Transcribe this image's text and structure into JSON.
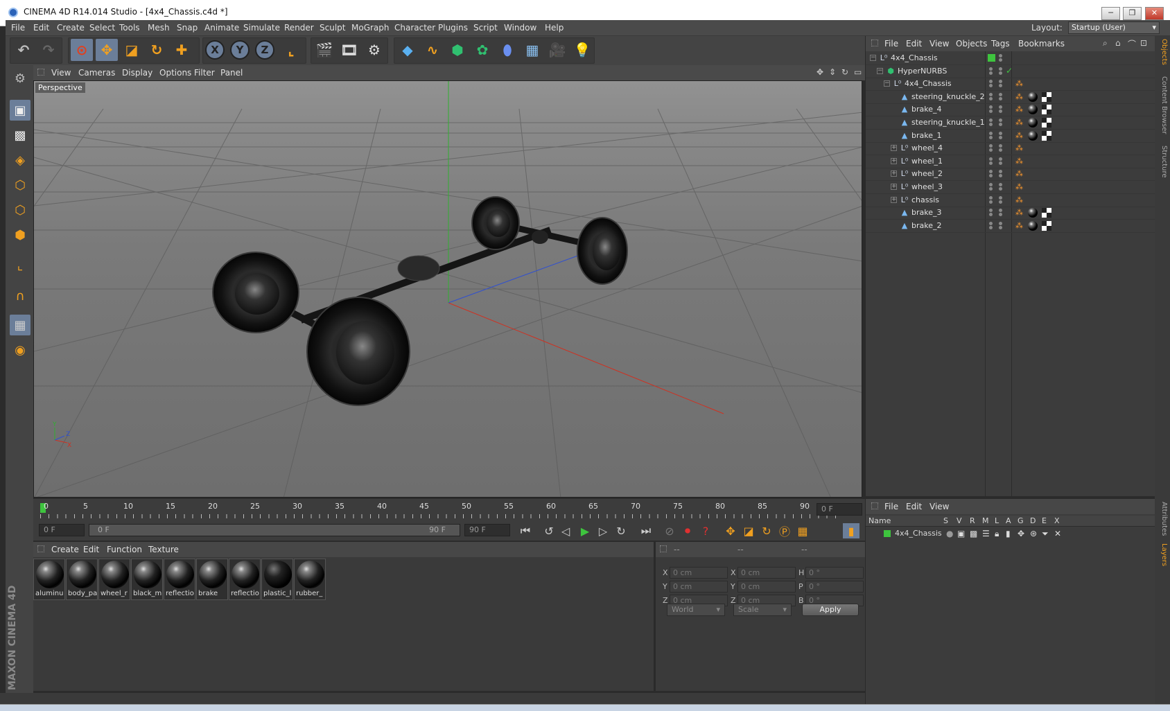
{
  "window": {
    "title": "CINEMA 4D R14.014 Studio - [4x4_Chassis.c4d *]",
    "minimize": "─",
    "restore": "❐",
    "close": "✕"
  },
  "menu": [
    "File",
    "Edit",
    "Create",
    "Select",
    "Tools",
    "Mesh",
    "Snap",
    "Animate",
    "Simulate",
    "Render",
    "Sculpt",
    "MoGraph",
    "Character",
    "Plugins",
    "Script",
    "Window",
    "Help"
  ],
  "layout": {
    "label": "Layout:",
    "value": "Startup (User)"
  },
  "viewport": {
    "menu": [
      "View",
      "Cameras",
      "Display",
      "Options",
      "Filter",
      "Panel"
    ],
    "camera_label": "Perspective",
    "axis_y": "Y",
    "axis_z": "Z",
    "axis_x": "X"
  },
  "timeline": {
    "ticks": [
      "0",
      "5",
      "10",
      "15",
      "20",
      "25",
      "30",
      "35",
      "40",
      "45",
      "50",
      "55",
      "60",
      "65",
      "70",
      "75",
      "80",
      "85",
      "90"
    ],
    "end_frame": "0 F",
    "current_frame": "0 F",
    "range_start": "0 F",
    "range_end": "90 F",
    "max_frame": "90 F"
  },
  "material_panel": {
    "menu": [
      "Create",
      "Edit",
      "Function",
      "Texture"
    ],
    "materials": [
      "aluminu",
      "body_pa",
      "wheel_r",
      "black_m",
      "reflectio",
      "brake",
      "reflectio",
      "plastic_l",
      "rubber_"
    ]
  },
  "coord_panel": {
    "headers": [
      "--",
      "--",
      "--"
    ],
    "rows": [
      {
        "a": "X",
        "av": "0 cm",
        "b": "X",
        "bv": "0 cm",
        "c": "H",
        "cv": "0 °"
      },
      {
        "a": "Y",
        "av": "0 cm",
        "b": "Y",
        "bv": "0 cm",
        "c": "P",
        "cv": "0 °"
      },
      {
        "a": "Z",
        "av": "0 cm",
        "b": "Z",
        "bv": "0 cm",
        "c": "B",
        "cv": "0 °"
      }
    ],
    "space": "World",
    "mode": "Scale",
    "apply": "Apply"
  },
  "object_panel": {
    "menu": [
      "File",
      "Edit",
      "View",
      "Objects",
      "Tags",
      "Bookmarks"
    ],
    "objects": [
      {
        "name": "4x4_Chassis",
        "indent": 0,
        "icon": "null",
        "tags": ""
      },
      {
        "name": "HyperNURBS",
        "indent": 1,
        "icon": "hypernurbs",
        "tags": ""
      },
      {
        "name": "4x4_Chassis",
        "indent": 2,
        "icon": "null",
        "tags": "phong"
      },
      {
        "name": "steering_knuckle_2",
        "indent": 3,
        "icon": "poly",
        "tags": "full"
      },
      {
        "name": "brake_4",
        "indent": 3,
        "icon": "poly",
        "tags": "full"
      },
      {
        "name": "steering_knuckle_1",
        "indent": 3,
        "icon": "poly",
        "tags": "full"
      },
      {
        "name": "brake_1",
        "indent": 3,
        "icon": "poly",
        "tags": "full"
      },
      {
        "name": "wheel_4",
        "indent": 3,
        "icon": "null",
        "tags": "phong"
      },
      {
        "name": "wheel_1",
        "indent": 3,
        "icon": "null",
        "tags": "phong"
      },
      {
        "name": "wheel_2",
        "indent": 3,
        "icon": "null",
        "tags": "phong"
      },
      {
        "name": "wheel_3",
        "indent": 3,
        "icon": "null",
        "tags": "phong"
      },
      {
        "name": "chassis",
        "indent": 3,
        "icon": "null",
        "tags": "phong"
      },
      {
        "name": "brake_3",
        "indent": 3,
        "icon": "poly",
        "tags": "full"
      },
      {
        "name": "brake_2",
        "indent": 3,
        "icon": "poly",
        "tags": "full"
      }
    ]
  },
  "layer_panel": {
    "menu": [
      "File",
      "Edit",
      "View"
    ],
    "columns": [
      "Name",
      "S",
      "V",
      "R",
      "M",
      "L",
      "A",
      "G",
      "D",
      "E",
      "X"
    ],
    "layers": [
      {
        "name": "4x4_Chassis",
        "color": "#3ec43e"
      }
    ]
  },
  "right_tabs": [
    "Objects",
    "Content Browser",
    "Structure",
    "Attributes",
    "Layers"
  ],
  "brand": "MAXON CINEMA 4D",
  "colors": {
    "accent_green": "#3ec43e",
    "selected_tool": "#6b7e99",
    "orange": "#ff9b2e"
  }
}
